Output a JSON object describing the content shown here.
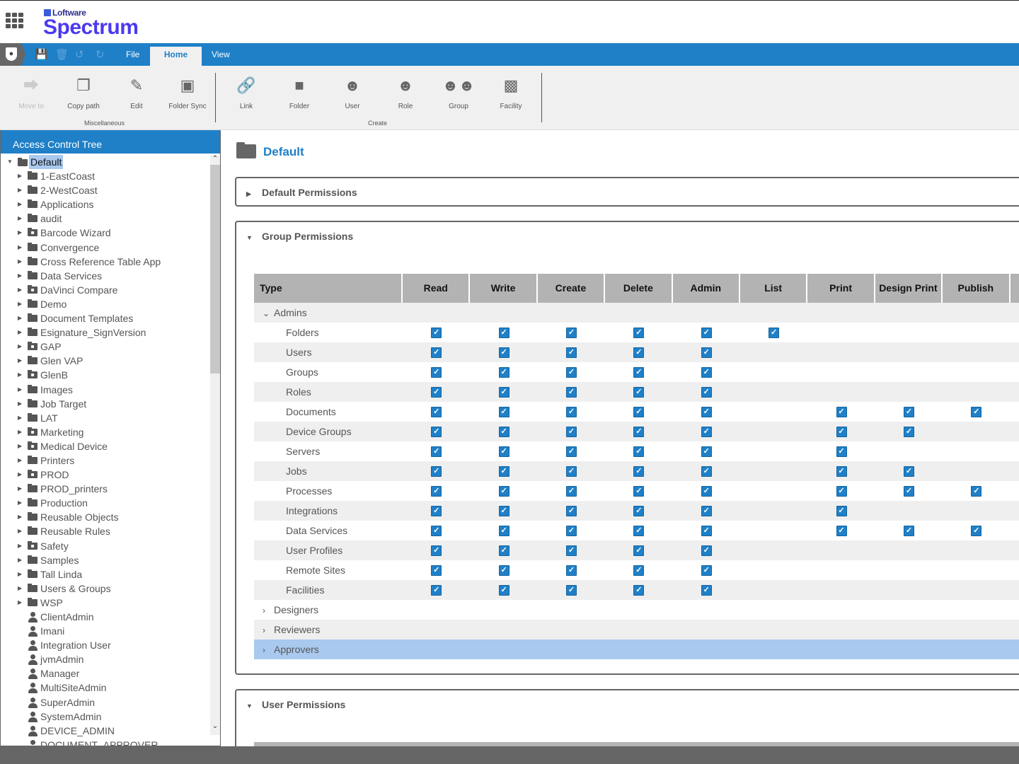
{
  "brand": {
    "company": "Loftware",
    "product": "Spectrum"
  },
  "menu": {
    "tabs": [
      {
        "label": "File"
      },
      {
        "label": "Home",
        "active": true
      },
      {
        "label": "View"
      }
    ]
  },
  "ribbon": {
    "misc": {
      "label": "Miscellaneous",
      "buttons": [
        {
          "label": "Move to",
          "icon": "move-icon",
          "disabled": true
        },
        {
          "label": "Copy path",
          "icon": "copy-icon"
        },
        {
          "label": "Edit",
          "icon": "edit-icon"
        },
        {
          "label": "Folder Sync",
          "icon": "folder-sync-icon"
        }
      ]
    },
    "create": {
      "label": "Create",
      "buttons": [
        {
          "label": "Link",
          "icon": "link-icon"
        },
        {
          "label": "Folder",
          "icon": "folder-icon"
        },
        {
          "label": "User",
          "icon": "user-icon"
        },
        {
          "label": "Role",
          "icon": "role-icon"
        },
        {
          "label": "Group",
          "icon": "group-icon"
        },
        {
          "label": "Facility",
          "icon": "facility-icon"
        }
      ]
    }
  },
  "tree": {
    "title": "Access Control Tree",
    "root": "Default",
    "items": [
      {
        "label": "1-EastCoast",
        "type": "folder"
      },
      {
        "label": "2-WestCoast",
        "type": "folder"
      },
      {
        "label": "Applications",
        "type": "folder"
      },
      {
        "label": "audit",
        "type": "folder"
      },
      {
        "label": "Barcode Wizard",
        "type": "locked"
      },
      {
        "label": "Convergence",
        "type": "folder"
      },
      {
        "label": "Cross Reference Table App",
        "type": "folder"
      },
      {
        "label": "Data Services",
        "type": "folder"
      },
      {
        "label": "DaVinci Compare",
        "type": "locked"
      },
      {
        "label": "Demo",
        "type": "folder"
      },
      {
        "label": "Document Templates",
        "type": "folder"
      },
      {
        "label": "Esignature_SignVersion",
        "type": "folder"
      },
      {
        "label": "GAP",
        "type": "locked"
      },
      {
        "label": "Glen VAP",
        "type": "folder"
      },
      {
        "label": "GlenB",
        "type": "locked"
      },
      {
        "label": "Images",
        "type": "folder"
      },
      {
        "label": "Job Target",
        "type": "folder"
      },
      {
        "label": "LAT",
        "type": "folder"
      },
      {
        "label": "Marketing",
        "type": "locked"
      },
      {
        "label": "Medical Device",
        "type": "locked"
      },
      {
        "label": "Printers",
        "type": "folder"
      },
      {
        "label": "PROD",
        "type": "locked"
      },
      {
        "label": "PROD_printers",
        "type": "folder"
      },
      {
        "label": "Production",
        "type": "folder"
      },
      {
        "label": "Reusable Objects",
        "type": "folder"
      },
      {
        "label": "Reusable Rules",
        "type": "folder"
      },
      {
        "label": "Safety",
        "type": "locked"
      },
      {
        "label": "Samples",
        "type": "folder"
      },
      {
        "label": "Tall Linda",
        "type": "folder"
      },
      {
        "label": "Users & Groups",
        "type": "folder"
      },
      {
        "label": "WSP",
        "type": "folder"
      },
      {
        "label": "ClientAdmin",
        "type": "user"
      },
      {
        "label": "Imani",
        "type": "user"
      },
      {
        "label": "Integration User",
        "type": "user"
      },
      {
        "label": "jvmAdmin",
        "type": "user"
      },
      {
        "label": "Manager",
        "type": "user"
      },
      {
        "label": "MultiSiteAdmin",
        "type": "user"
      },
      {
        "label": "SuperAdmin",
        "type": "user"
      },
      {
        "label": "SystemAdmin",
        "type": "user"
      },
      {
        "label": "DEVICE_ADMIN",
        "type": "role"
      },
      {
        "label": "DOCUMENT_APPROVER",
        "type": "role"
      }
    ]
  },
  "main": {
    "title": "Default",
    "sections": {
      "default": "Default Permissions",
      "group": "Group Permissions",
      "user": "User Permissions"
    },
    "columns": [
      "Type",
      "Read",
      "Write",
      "Create",
      "Delete",
      "Admin",
      "List",
      "Print",
      "Design Print",
      "Publish"
    ],
    "groups": [
      {
        "name": "Admins",
        "expanded": true,
        "rows": [
          {
            "type": "Folders",
            "perms": [
              1,
              1,
              1,
              1,
              1,
              1,
              0,
              0,
              0
            ]
          },
          {
            "type": "Users",
            "perms": [
              1,
              1,
              1,
              1,
              1,
              0,
              0,
              0,
              0
            ]
          },
          {
            "type": "Groups",
            "perms": [
              1,
              1,
              1,
              1,
              1,
              0,
              0,
              0,
              0
            ]
          },
          {
            "type": "Roles",
            "perms": [
              1,
              1,
              1,
              1,
              1,
              0,
              0,
              0,
              0
            ]
          },
          {
            "type": "Documents",
            "perms": [
              1,
              1,
              1,
              1,
              1,
              0,
              1,
              1,
              1
            ]
          },
          {
            "type": "Device Groups",
            "perms": [
              1,
              1,
              1,
              1,
              1,
              0,
              1,
              1,
              0
            ]
          },
          {
            "type": "Servers",
            "perms": [
              1,
              1,
              1,
              1,
              1,
              0,
              1,
              0,
              0
            ]
          },
          {
            "type": "Jobs",
            "perms": [
              1,
              1,
              1,
              1,
              1,
              0,
              1,
              1,
              0
            ]
          },
          {
            "type": "Processes",
            "perms": [
              1,
              1,
              1,
              1,
              1,
              0,
              1,
              1,
              1
            ]
          },
          {
            "type": "Integrations",
            "perms": [
              1,
              1,
              1,
              1,
              1,
              0,
              1,
              0,
              0
            ]
          },
          {
            "type": "Data Services",
            "perms": [
              1,
              1,
              1,
              1,
              1,
              0,
              1,
              1,
              1
            ]
          },
          {
            "type": "User Profiles",
            "perms": [
              1,
              1,
              1,
              1,
              1,
              0,
              0,
              0,
              0
            ]
          },
          {
            "type": "Remote Sites",
            "perms": [
              1,
              1,
              1,
              1,
              1,
              0,
              0,
              0,
              0
            ]
          },
          {
            "type": "Facilities",
            "perms": [
              1,
              1,
              1,
              1,
              1,
              0,
              0,
              0,
              0
            ]
          }
        ]
      },
      {
        "name": "Designers",
        "expanded": false
      },
      {
        "name": "Reviewers",
        "expanded": false
      },
      {
        "name": "Approvers",
        "expanded": false,
        "selected": true
      }
    ]
  },
  "colors": {
    "accent": "#1f80c8",
    "brand": "#4a3aef",
    "selection": "#a9c9ef"
  }
}
